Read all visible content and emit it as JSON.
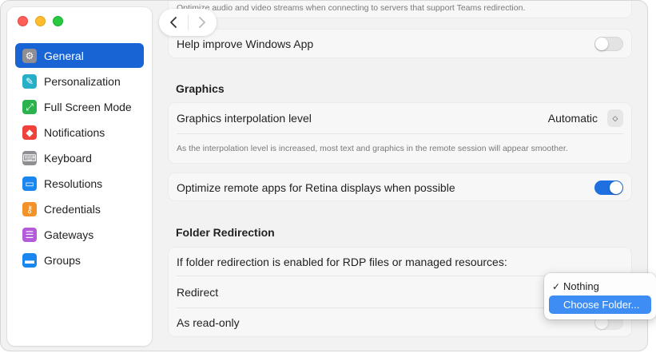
{
  "sidebar": {
    "items": [
      {
        "label": "General",
        "icon": "gear-icon",
        "color": "#8e8e93",
        "glyph": "⚙",
        "active": true
      },
      {
        "label": "Personalization",
        "icon": "brush-icon",
        "color": "#25b0c8",
        "glyph": "✎"
      },
      {
        "label": "Full Screen Mode",
        "icon": "fullscreen-icon",
        "color": "#2bb24c",
        "glyph": "⤢"
      },
      {
        "label": "Notifications",
        "icon": "bell-icon",
        "color": "#f0413a",
        "glyph": "◆"
      },
      {
        "label": "Keyboard",
        "icon": "keyboard-icon",
        "color": "#8e8e93",
        "glyph": "⌨"
      },
      {
        "label": "Resolutions",
        "icon": "display-icon",
        "color": "#1a87f0",
        "glyph": "▭"
      },
      {
        "label": "Credentials",
        "icon": "key-icon",
        "color": "#f2932a",
        "glyph": "⚷"
      },
      {
        "label": "Gateways",
        "icon": "gateway-icon",
        "color": "#b35bd9",
        "glyph": "☰"
      },
      {
        "label": "Groups",
        "icon": "folder-icon",
        "color": "#1a87f0",
        "glyph": "▬"
      }
    ]
  },
  "main": {
    "clipped_text": "Optimize audio and video streams when connecting to servers that support Teams redirection.",
    "help_improve_label": "Help improve Windows App",
    "graphics_heading": "Graphics",
    "interpolation_label": "Graphics interpolation level",
    "interpolation_value": "Automatic",
    "interpolation_note": "As the interpolation level is increased, most text and graphics in the remote session will appear smoother.",
    "retina_label": "Optimize remote apps for Retina displays when possible",
    "folder_heading": "Folder Redirection",
    "folder_intro": "If folder redirection is enabled for RDP files or managed resources:",
    "redirect_label": "Redirect",
    "readonly_label": "As read-only"
  },
  "popup": {
    "items": [
      {
        "label": "Nothing",
        "checked": true
      },
      {
        "label": "Choose Folder...",
        "highlighted": true
      }
    ]
  },
  "colors": {
    "accent": "#1864d4",
    "toggle_on": "#1f6fe0",
    "highlight": "#3d8df5"
  }
}
